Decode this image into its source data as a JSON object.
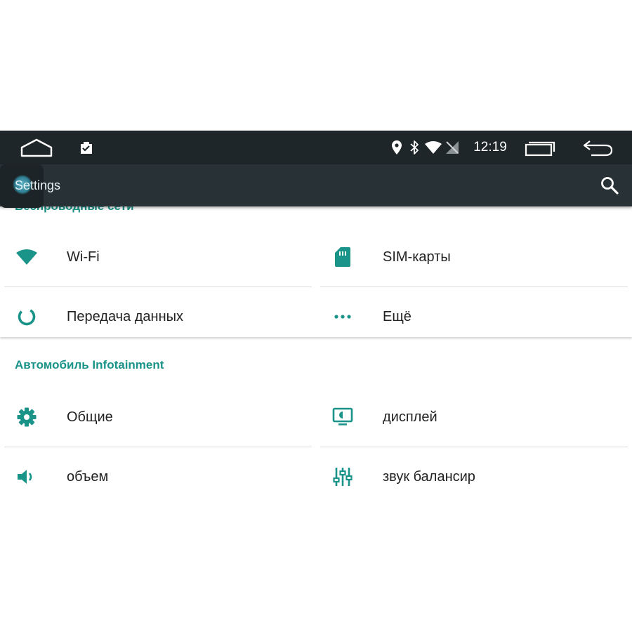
{
  "status_bar": {
    "time": "12:19",
    "icons": [
      "home-icon",
      "clipboard-check-icon",
      "location-icon",
      "bluetooth-icon",
      "wifi-icon",
      "no-signal-icon",
      "recent-apps-icon",
      "back-icon"
    ]
  },
  "toolbar": {
    "title": "Settings",
    "search_icon": "search-icon"
  },
  "sections": [
    {
      "title": "Беспроводные сети",
      "items": [
        {
          "label": "Wi-Fi",
          "icon": "wifi-icon"
        },
        {
          "label": "SIM-карты",
          "icon": "sim-card-icon"
        },
        {
          "label": "Передача данных",
          "icon": "data-usage-icon"
        },
        {
          "label": "Ещё",
          "icon": "more-icon"
        }
      ]
    },
    {
      "title": "Автомобиль Infotainment",
      "items": [
        {
          "label": "Общие",
          "icon": "gear-icon"
        },
        {
          "label": "дисплей",
          "icon": "display-icon"
        },
        {
          "label": "объем",
          "icon": "volume-icon"
        },
        {
          "label": "звук балансир",
          "icon": "equalizer-icon"
        }
      ]
    }
  ],
  "colors": {
    "accent": "#1a9388",
    "status_bar": "#1f2629",
    "toolbar": "#283236"
  }
}
